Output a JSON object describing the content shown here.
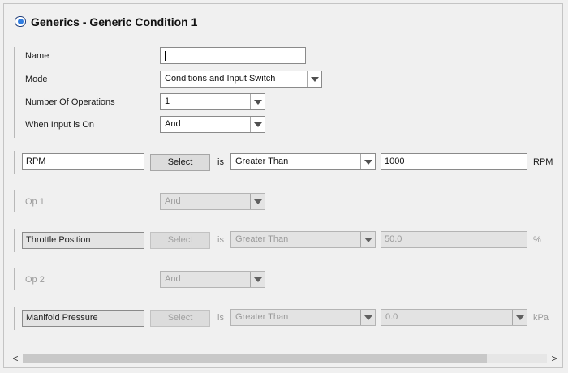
{
  "window": {
    "title": "Generics - Generic Condition 1"
  },
  "form": {
    "name_label": "Name",
    "name_value": "",
    "mode_label": "Mode",
    "mode_value": "Conditions and Input Switch",
    "ops_label": "Number Of Operations",
    "ops_value": "1",
    "input_on_label": "When Input is On",
    "input_on_value": "And"
  },
  "conditions": [
    {
      "channel": "RPM",
      "select_label": "Select",
      "is_label": "is",
      "operator": "Greater Than",
      "value": "1000",
      "unit": "RPM"
    },
    {
      "channel": "Throttle Position",
      "select_label": "Select",
      "is_label": "is",
      "operator": "Greater Than",
      "value": "50.0",
      "unit": "%"
    },
    {
      "channel": "Manifold Pressure",
      "select_label": "Select",
      "is_label": "is",
      "operator": "Greater Than",
      "value": "0.0",
      "unit": "kPa"
    }
  ],
  "operations": [
    {
      "label": "Op 1",
      "value": "And"
    },
    {
      "label": "Op 2",
      "value": "And"
    }
  ],
  "scrollbar": {
    "left_arrow": "<",
    "right_arrow": ">"
  }
}
